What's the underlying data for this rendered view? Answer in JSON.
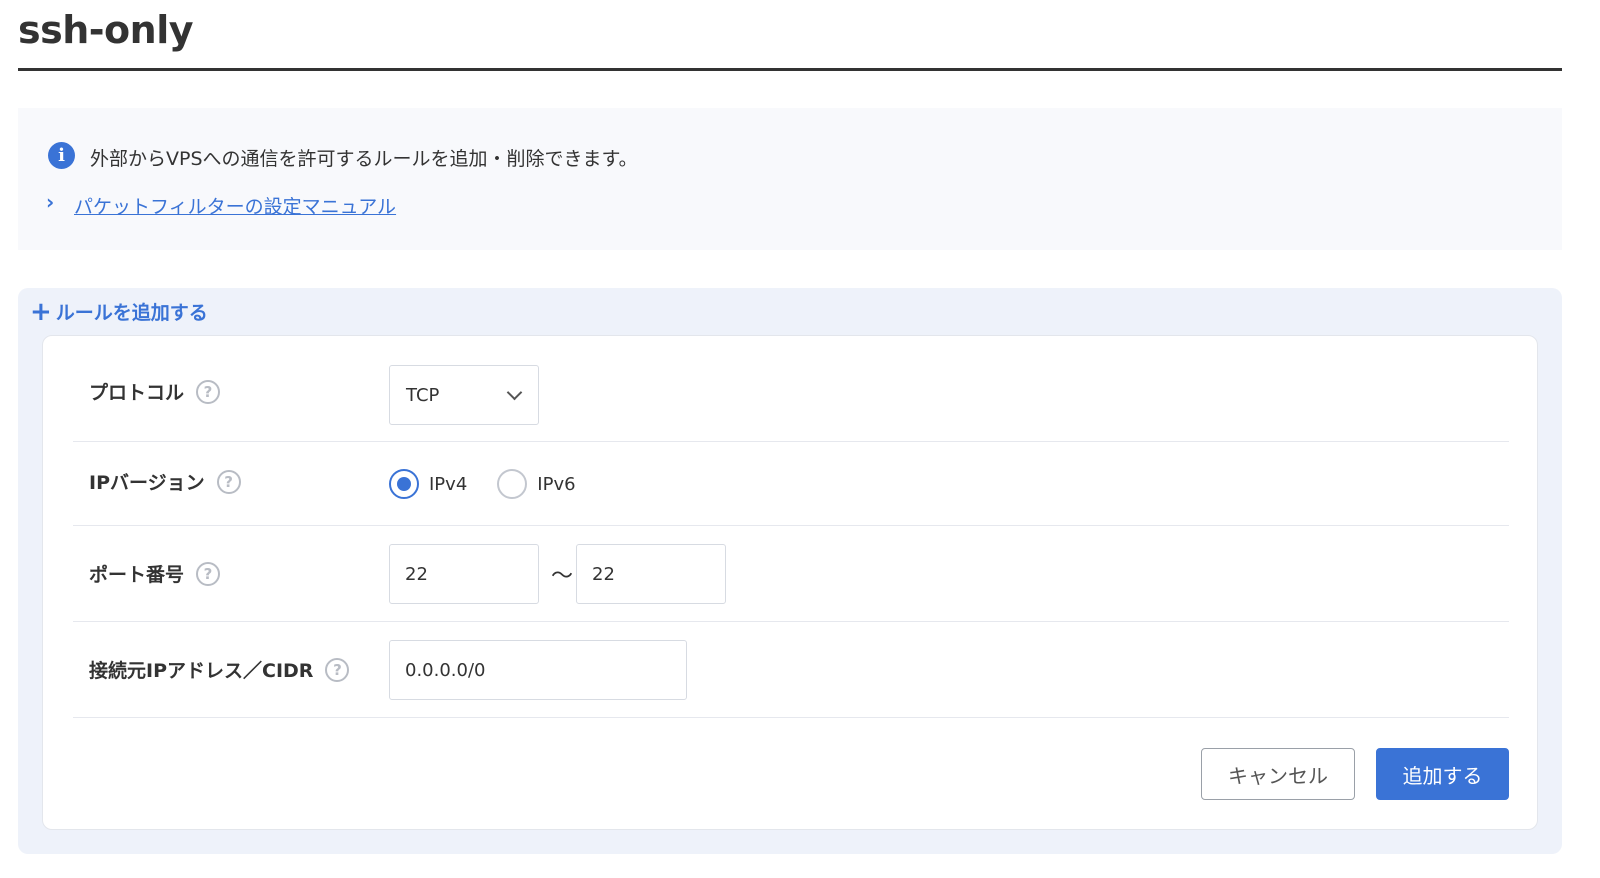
{
  "page": {
    "title": "ssh-only"
  },
  "info": {
    "message": "外部からVPSへの通信を許可するルールを追加・削除できます。",
    "manual_link": "パケットフィルターの設定マニュアル",
    "info_icon": "i",
    "chevron": "›"
  },
  "rule_section": {
    "add_toggle_label": "ルールを追加する",
    "plus": "+"
  },
  "form": {
    "protocol": {
      "label": "プロトコル",
      "value": "TCP"
    },
    "ip_version": {
      "label": "IPバージョン",
      "options": [
        "IPv4",
        "IPv6"
      ],
      "selected": "IPv4"
    },
    "port": {
      "label": "ポート番号",
      "from": "22",
      "separator": "〜",
      "to": "22"
    },
    "source": {
      "label": "接続元IPアドレス／CIDR",
      "value": "0.0.0.0/0"
    },
    "help": "?"
  },
  "buttons": {
    "cancel": "キャンセル",
    "submit": "追加する"
  },
  "colors": {
    "accent": "#3a73d6",
    "text": "#333333",
    "panel_bg": "#eef2fa"
  }
}
